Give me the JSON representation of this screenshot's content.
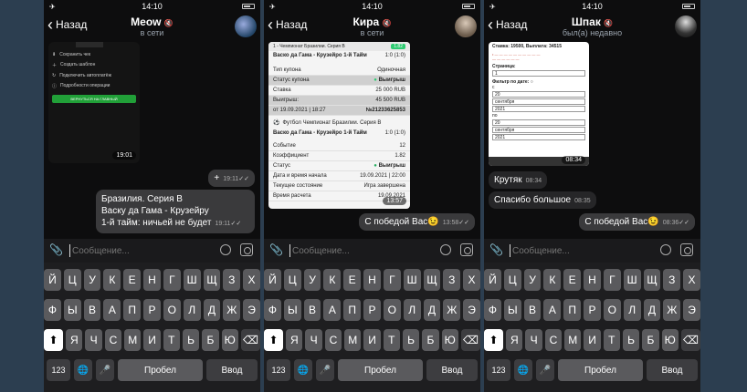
{
  "status": {
    "time": "14:10"
  },
  "phones": [
    {
      "back_label": "Назад",
      "title": "Meow",
      "subtitle": "в сети",
      "screenshot_time": "19:01",
      "menu_items": [
        "Сохранить чек",
        "Создать шаблон",
        "Подключить автоплатёж",
        "Подробности операции"
      ],
      "menu_button": "ВЕРНУТЬСЯ НА ГЛАВНЫЙ",
      "plus_msg": {
        "text": "+",
        "time": "19:11"
      },
      "text_msg": {
        "lines": [
          "Бразилия. Серия В",
          "Васку да Гама - Крузейру",
          "1-й тайм: ничьей не будет"
        ],
        "time": "19:11"
      },
      "input_placeholder": "Сообщение..."
    },
    {
      "back_label": "Назад",
      "title": "Кира",
      "subtitle": "в сети",
      "card": {
        "header": "1 - Чемпионат Бразилии. Серия B",
        "odds_badge": "1.82",
        "match": "Васко да Гама - Крузейро 1-й Тайм",
        "match_score": "1:0 (1:0)",
        "rows": [
          {
            "k": "Тип купона",
            "v": "Одиночная"
          },
          {
            "k": "Статус купона",
            "v": "Выигрыш"
          },
          {
            "k": "Ставка",
            "v": "25 000 RUB"
          },
          {
            "k": "Выигрыш:",
            "v": "45 500 RUB"
          },
          {
            "k": "от 19.09.2021 | 18:27",
            "v": "№21233625853"
          }
        ],
        "sport_header": "Футбол Чемпионат Бразилии. Серия B",
        "match2": "Васко да Гама - Крузейро 1-й Тайм",
        "match2_score": "1:0 (1:0)",
        "rows2": [
          {
            "k": "Событие",
            "v": "12"
          },
          {
            "k": "Коэффициент",
            "v": "1.82"
          },
          {
            "k": "Статус",
            "v": "Выигрыш"
          },
          {
            "k": "Дата и время начала",
            "v": "19.09.2021 | 22:00"
          },
          {
            "k": "Текущее состояние",
            "v": "Игра завершена"
          },
          {
            "k": "Время расчета",
            "v": "19.09.2021"
          }
        ],
        "time": "13:57"
      },
      "msg": {
        "text": "С победой Вас😉",
        "time": "13:58"
      },
      "input_placeholder": "Сообщение..."
    },
    {
      "back_label": "Назад",
      "title": "Шпак",
      "subtitle": "был(а) недавно",
      "card": {
        "header": "Ставка: 19500, Выплата: 34515",
        "page_label": "Страница:",
        "page_value": "1",
        "filter_label": "Фильтр по дате:",
        "from_label": "с",
        "from": [
          "20",
          "сентября",
          "2021"
        ],
        "to_label": "по",
        "to": [
          "20",
          "сентября",
          "2021"
        ],
        "time": "08:34"
      },
      "msgs": [
        {
          "text": "Крутяк",
          "time": "08:34"
        },
        {
          "text": "Спасибо большое",
          "time": "08:35"
        }
      ],
      "out_msg": {
        "text": "С победой Вас😉",
        "time": "08:36"
      },
      "input_placeholder": "Сообщение..."
    }
  ],
  "keyboard": {
    "row1": [
      "Й",
      "Ц",
      "У",
      "К",
      "Е",
      "Н",
      "Г",
      "Ш",
      "Щ",
      "З",
      "Х"
    ],
    "row2": [
      "Ф",
      "Ы",
      "В",
      "А",
      "П",
      "Р",
      "О",
      "Л",
      "Д",
      "Ж",
      "Э"
    ],
    "row3": [
      "Я",
      "Ч",
      "С",
      "М",
      "И",
      "Т",
      "Ь",
      "Б",
      "Ю"
    ],
    "num": "123",
    "space": "Пробел",
    "enter": "Ввод"
  },
  "colors": {
    "accent_green": "#2ecc71",
    "win_green": "#27ae60"
  }
}
